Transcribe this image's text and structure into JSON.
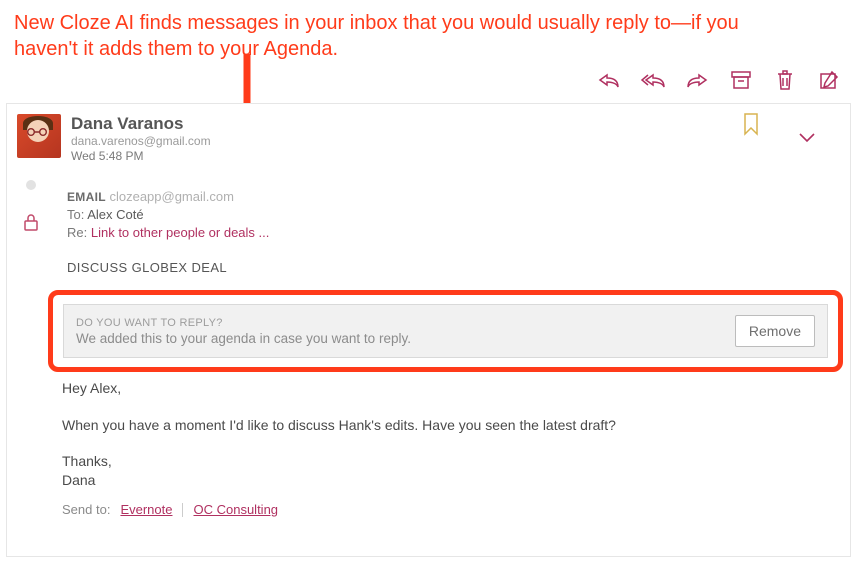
{
  "annotation": "New Cloze AI finds messages in your inbox that you would usually reply to—if you haven't it adds them to your Agenda.",
  "toolbar": {
    "reply": "Reply",
    "reply_all": "Reply All",
    "forward": "Forward",
    "archive": "Archive",
    "delete": "Delete",
    "compose": "Compose"
  },
  "sender": {
    "name": "Dana Varanos",
    "email": "dana.varenos@gmail.com",
    "time": "Wed 5:48 PM"
  },
  "meta": {
    "email_label": "EMAIL",
    "account": "clozeapp@gmail.com",
    "to_label": "To:",
    "to_value": "Alex Coté",
    "re_label": "Re:",
    "re_link": "Link to other people or deals ..."
  },
  "subject": "DISCUSS GLOBEX DEAL",
  "agenda": {
    "question": "DO YOU WANT TO REPLY?",
    "detail": "We added this to your agenda in case you want to reply.",
    "remove": "Remove"
  },
  "body": {
    "p1": "Hey Alex,",
    "p2": "When you have a moment I'd like to discuss Hank's edits. Have you seen the latest draft?",
    "sig1": "Thanks,",
    "sig2": "Dana"
  },
  "send_to": {
    "label": "Send to:",
    "link1": "Evernote",
    "link2": "OC Consulting"
  }
}
